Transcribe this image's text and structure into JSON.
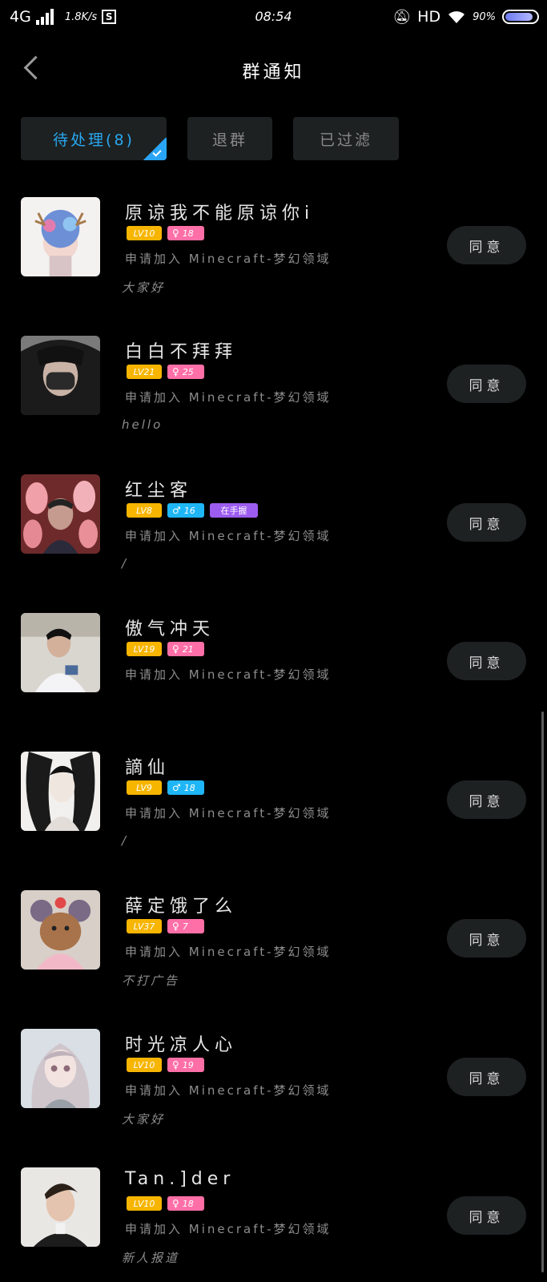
{
  "status_bar": {
    "network": "4G",
    "speed": "1.8K/s",
    "time": "08:54",
    "hd": "HD",
    "battery": "90%"
  },
  "header": {
    "title": "群通知"
  },
  "tabs": [
    {
      "label": "待处理(8)",
      "active": true
    },
    {
      "label": "退群",
      "active": false
    },
    {
      "label": "已过滤",
      "active": false
    }
  ],
  "requests": [
    {
      "name": "原谅我不能原谅你i",
      "level": "LV10",
      "gender": "female",
      "age": "18",
      "tag": "",
      "apply": "申请加入 Minecraft-梦幻领域",
      "message": "大家好",
      "action": "同意"
    },
    {
      "name": "白白不拜拜",
      "level": "LV21",
      "gender": "female",
      "age": "25",
      "tag": "",
      "apply": "申请加入 Minecraft-梦幻领域",
      "message": "hello",
      "action": "同意"
    },
    {
      "name": "红尘客",
      "level": "LV8",
      "gender": "male",
      "age": "16",
      "tag": "在手握",
      "apply": "申请加入 Minecraft-梦幻领域",
      "message": "/",
      "action": "同意"
    },
    {
      "name": "傲气冲天",
      "level": "LV19",
      "gender": "female",
      "age": "21",
      "tag": "",
      "apply": "申请加入 Minecraft-梦幻领域",
      "message": "",
      "action": "同意"
    },
    {
      "name": "謫仙",
      "level": "LV9",
      "gender": "male",
      "age": "18",
      "tag": "",
      "apply": "申请加入 Minecraft-梦幻领域",
      "message": "/",
      "action": "同意"
    },
    {
      "name": "薛定饿了么",
      "level": "LV37",
      "gender": "female",
      "age": "7",
      "tag": "",
      "apply": "申请加入 Minecraft-梦幻领域",
      "message": "不打广告",
      "action": "同意"
    },
    {
      "name": "时光凉人心",
      "level": "LV10",
      "gender": "female",
      "age": "19",
      "tag": "",
      "apply": "申请加入 Minecraft-梦幻领域",
      "message": "大家好",
      "action": "同意"
    },
    {
      "name": "Tan.]der",
      "level": "LV10",
      "gender": "female",
      "age": "18",
      "tag": "",
      "apply": "申请加入 Minecraft-梦幻领域",
      "message": "新人报道",
      "action": "同意"
    }
  ],
  "colors": {
    "accent": "#28a8f0",
    "level_badge": "#f7b500",
    "female_badge": "#ff6fa7",
    "male_badge": "#1fb6f7",
    "tag_badge": "#9d5cf0"
  }
}
